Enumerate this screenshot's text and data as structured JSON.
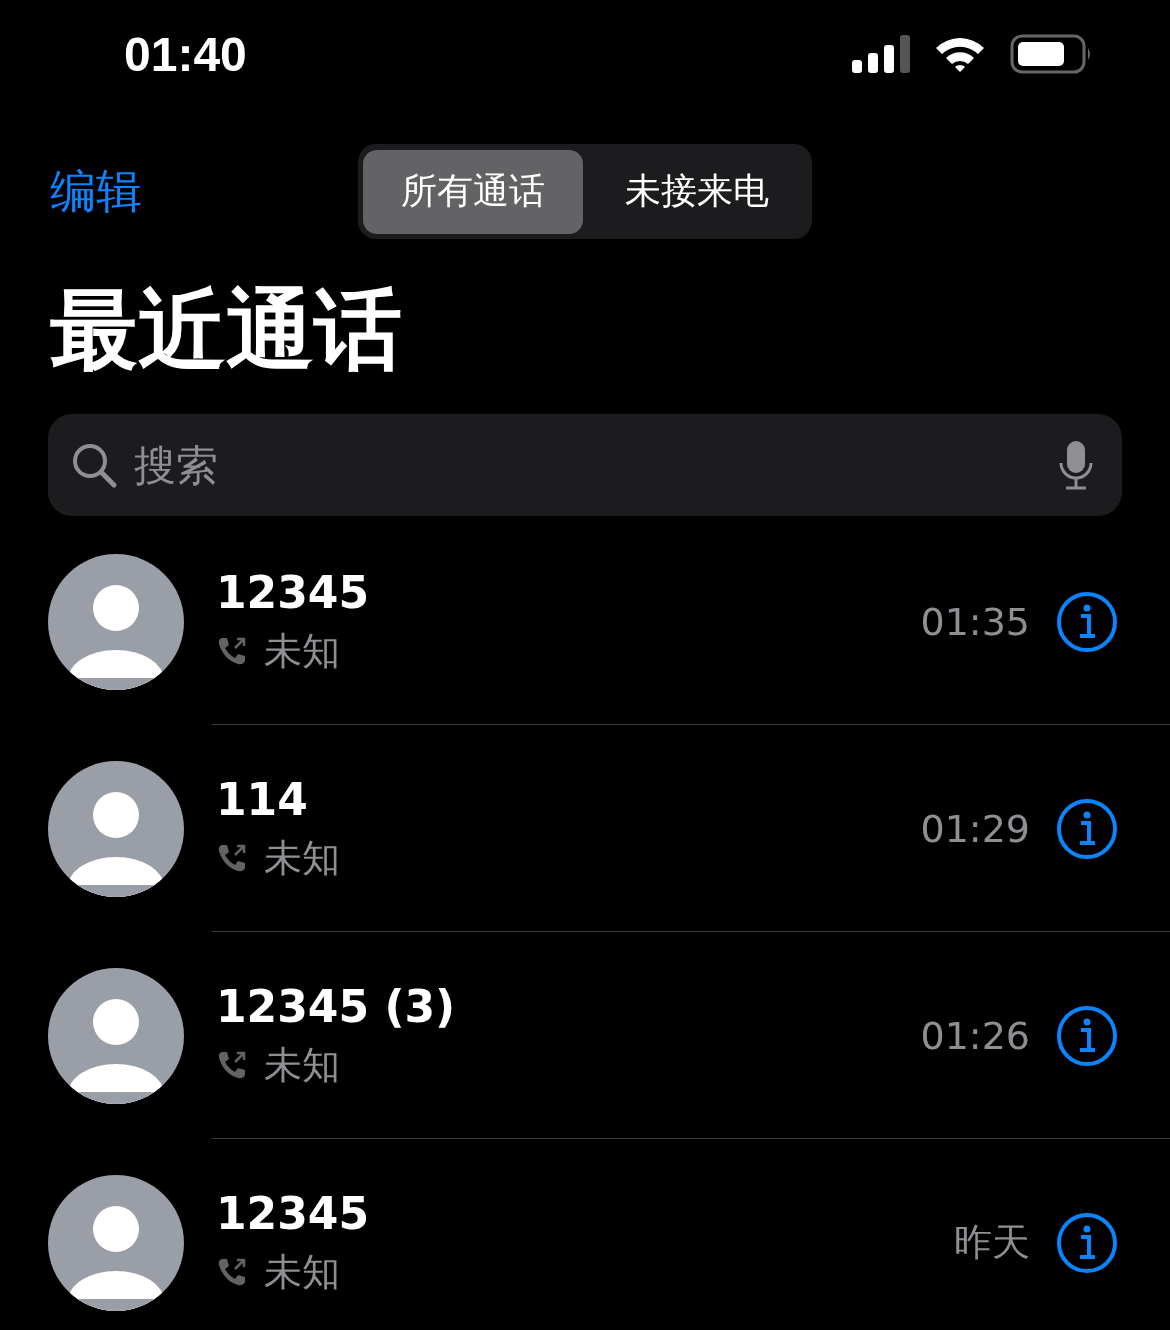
{
  "status_bar": {
    "time": "01:40"
  },
  "nav": {
    "edit": "编辑",
    "segments": [
      {
        "label": "所有通话",
        "selected": true
      },
      {
        "label": "未接来电",
        "selected": false
      }
    ]
  },
  "title": "最近通话",
  "search": {
    "placeholder": "搜索"
  },
  "calls": [
    {
      "name": "12345",
      "type": "未知",
      "time": "01:35"
    },
    {
      "name": "114",
      "type": "未知",
      "time": "01:29"
    },
    {
      "name": "12345 (3)",
      "type": "未知",
      "time": "01:26"
    },
    {
      "name": "12345",
      "type": "未知",
      "time": "昨天"
    }
  ]
}
